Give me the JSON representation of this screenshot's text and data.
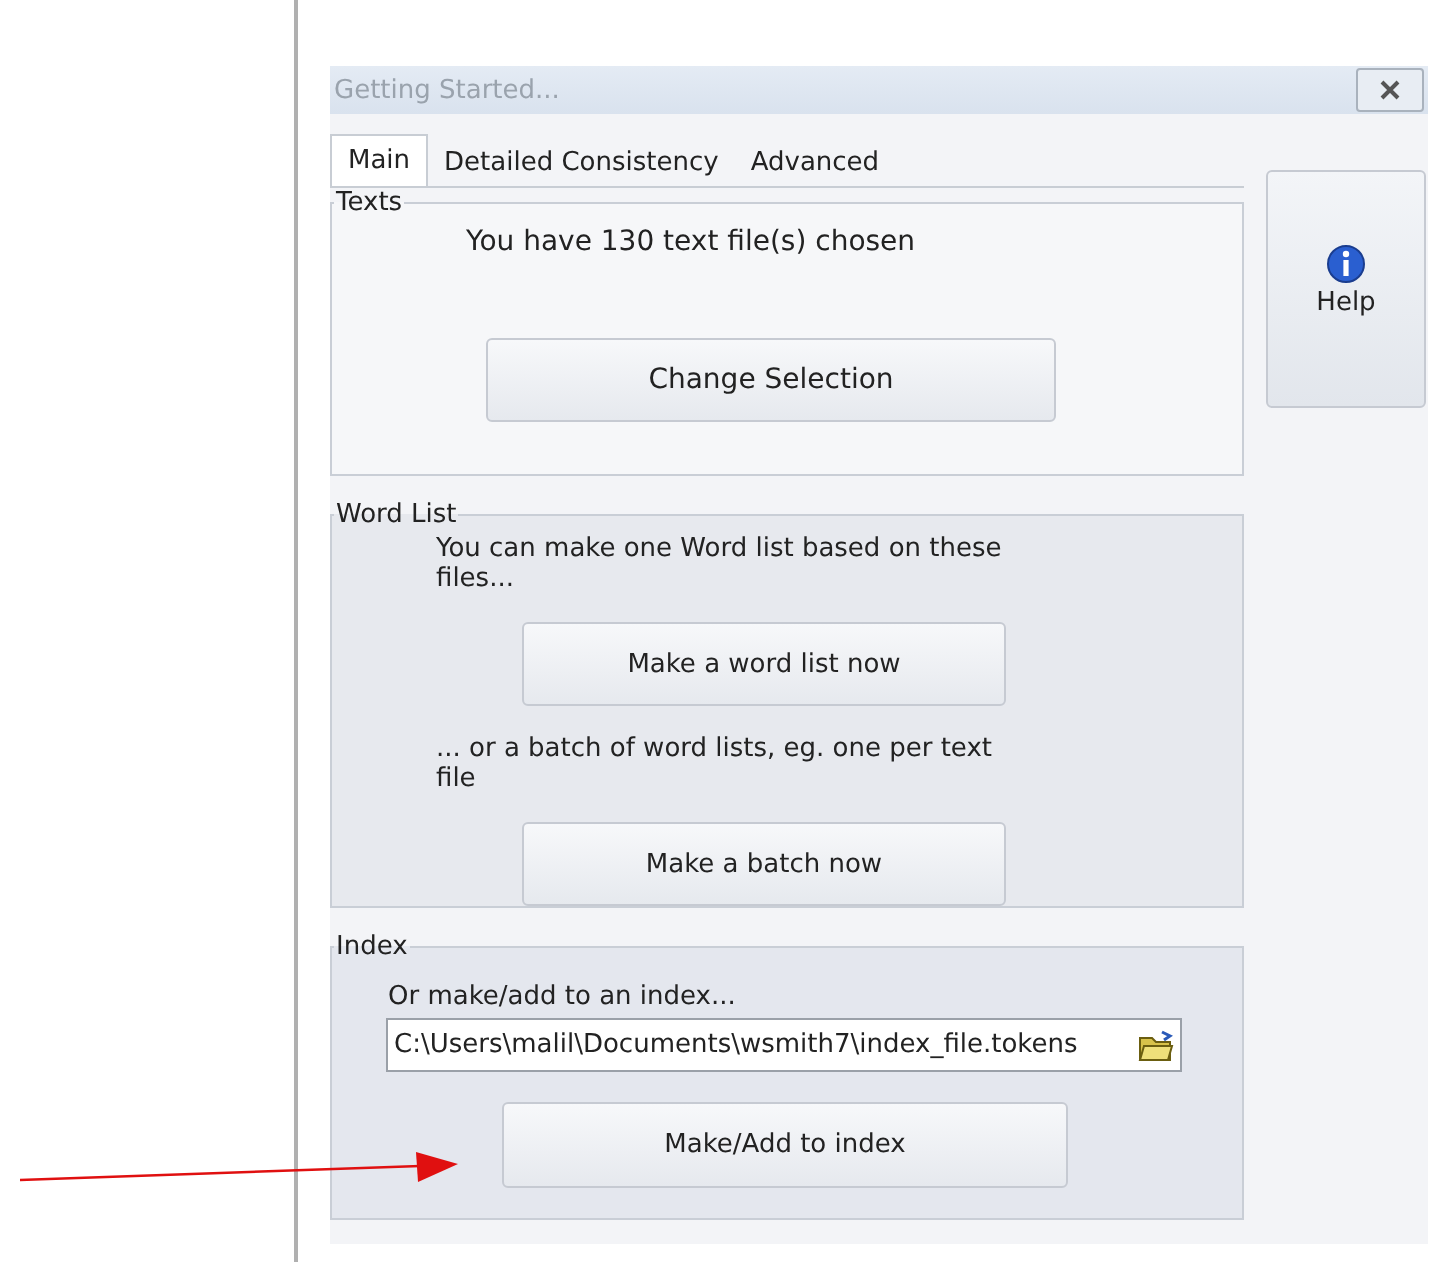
{
  "window": {
    "title": "Getting Started..."
  },
  "tabs": [
    {
      "label": "Main",
      "selected": true
    },
    {
      "label": "Detailed Consistency",
      "selected": false
    },
    {
      "label": "Advanced",
      "selected": false
    }
  ],
  "groups": [
    {
      "legend": "Texts",
      "items": [
        {
          "kind": "text",
          "text": "You have 130 text file(s) chosen"
        },
        {
          "kind": "button",
          "label": "Change Selection"
        }
      ]
    },
    {
      "legend": "Word List",
      "items": [
        {
          "kind": "text",
          "text": "You can make one Word list based on these files..."
        },
        {
          "kind": "button",
          "label": "Make a word list now"
        },
        {
          "kind": "text",
          "text": "... or a batch of word lists, eg. one per text file"
        },
        {
          "kind": "button",
          "label": "Make a batch now"
        }
      ]
    },
    {
      "legend": "Index",
      "items": [
        {
          "kind": "text",
          "text": "Or make/add to an index..."
        },
        {
          "kind": "field",
          "value": "C:\\Users\\malil\\Documents\\wsmith7\\index_file.tokens"
        },
        {
          "kind": "button",
          "label": "Make/Add to index"
        }
      ]
    }
  ],
  "help_button": {
    "label": "Help"
  }
}
